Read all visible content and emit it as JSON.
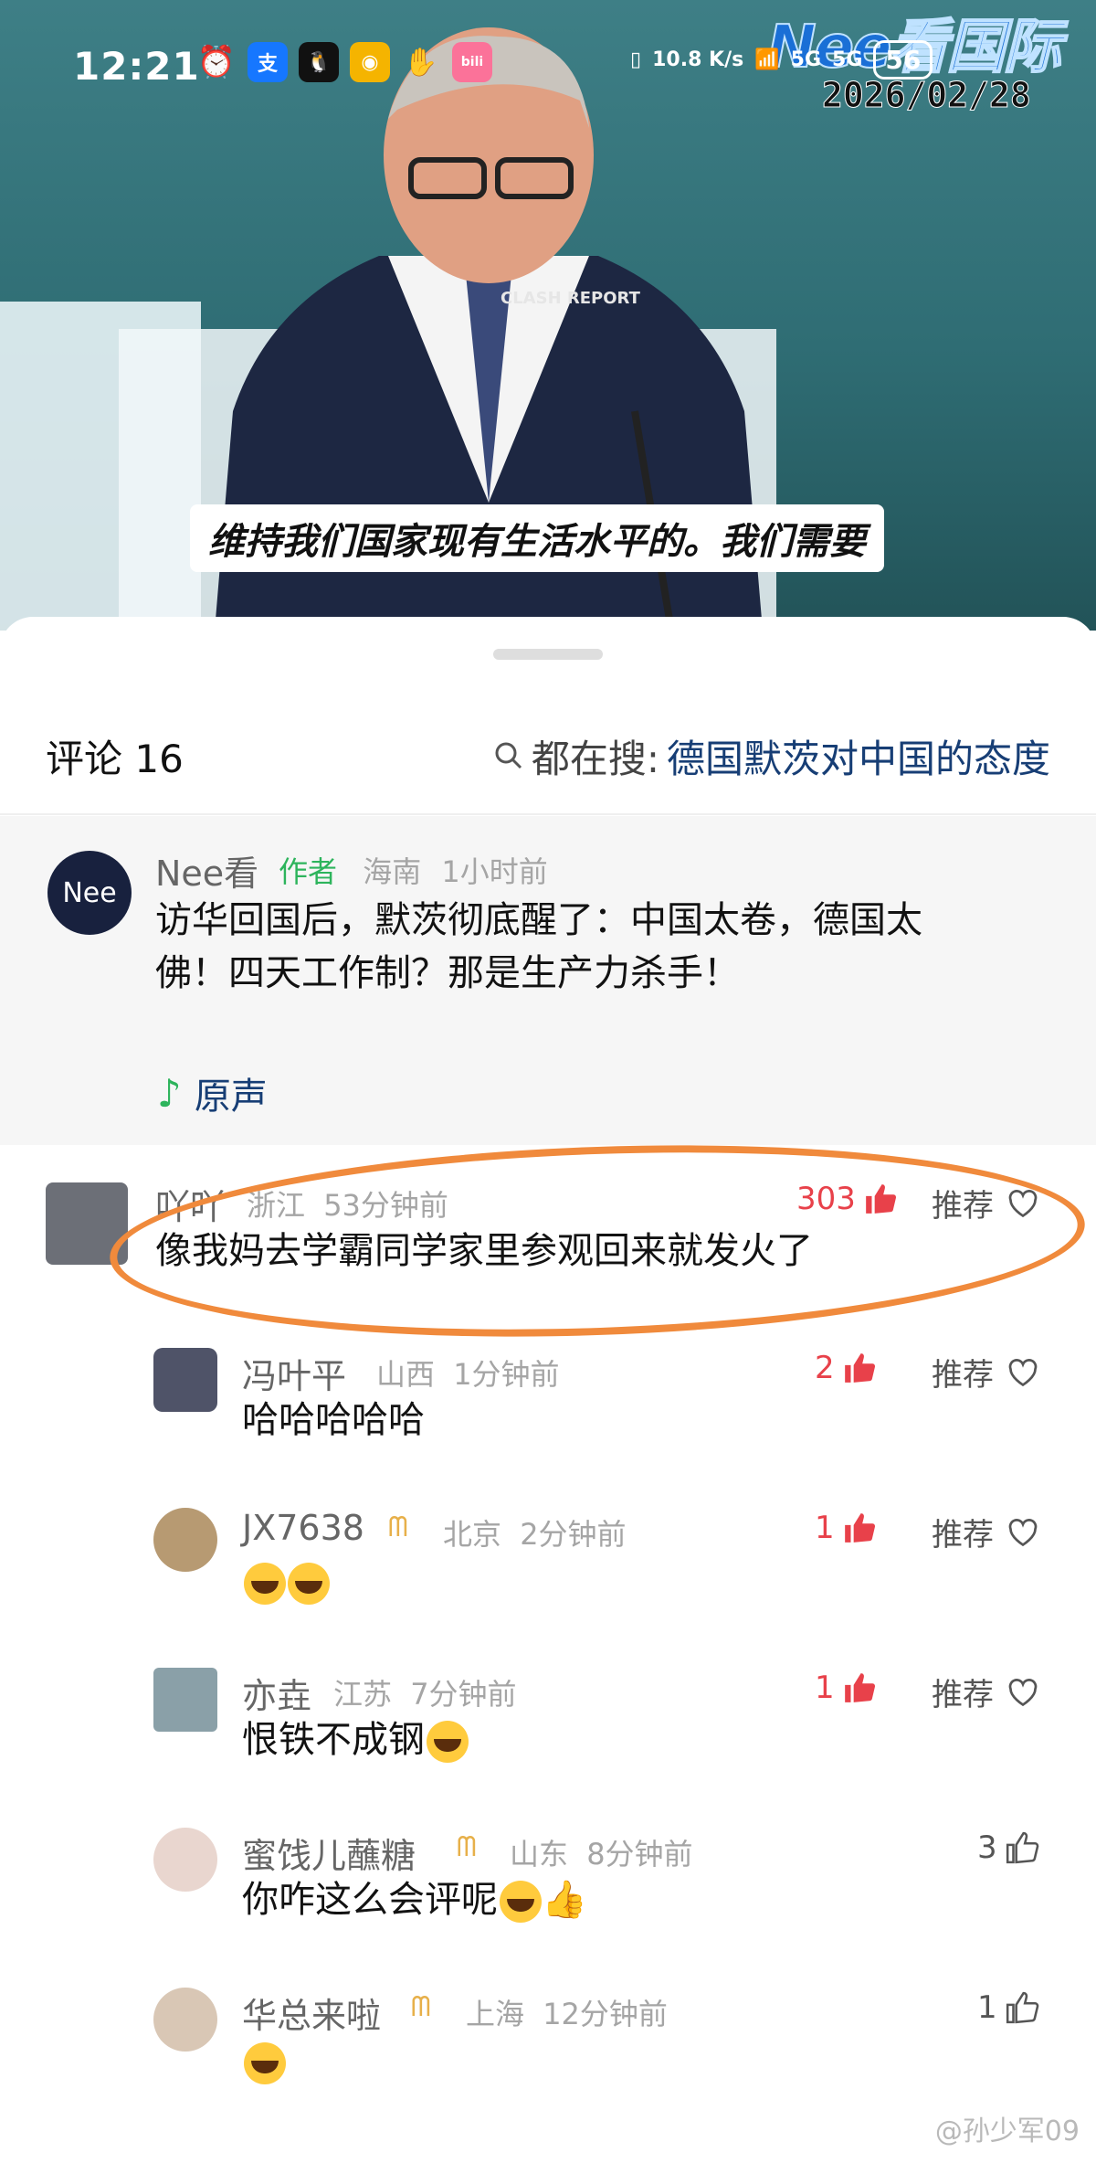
{
  "status_bar": {
    "time": "12:21",
    "net_speed": "10.8 K/s",
    "signal_a": "5G",
    "signal_b": "5G",
    "battery": "56"
  },
  "video": {
    "channel_logo": "Nee看国际",
    "date": "2026/02/28",
    "watermark": "CLASH REPORT",
    "subtitle": "维持我们国家现有生活水平的。我们需要"
  },
  "comments_header": {
    "title": "评论 16",
    "search_prefix": "都在搜:",
    "search_term": "德国默茨对中国的态度"
  },
  "author_post": {
    "avatar_text": "Nee",
    "name": "Nee看",
    "badge": "作者",
    "location": "海南",
    "time": "1小时前",
    "line1": "访华回国后，默茨彻底醒了：中国太卷，德国太",
    "line2": "佛！四天工作制？那是生产力杀手！",
    "original_sound": "原声"
  },
  "comments": [
    {
      "name": "吖吖",
      "location": "浙江",
      "time": "53分钟前",
      "likes": "303",
      "recommend": "推荐",
      "text": "像我妈去学霸同学家里参观回来就发火了"
    },
    {
      "name": "冯叶平",
      "location": "山西",
      "time": "1分钟前",
      "likes": "2",
      "recommend": "推荐",
      "text": "哈哈哈哈哈"
    },
    {
      "name": "JX7638",
      "location": "北京",
      "time": "2分钟前",
      "likes": "1",
      "recommend": "推荐",
      "text": ""
    },
    {
      "name": "亦垚",
      "location": "江苏",
      "time": "7分钟前",
      "likes": "1",
      "recommend": "推荐",
      "text": "恨铁不成钢"
    },
    {
      "name": "蜜饯儿蘸糖",
      "location": "山东",
      "time": "8分钟前",
      "likes": "3",
      "text": "你咋这么会评呢"
    },
    {
      "name": "华总来啦",
      "location": "上海",
      "time": "12分钟前",
      "likes": "1",
      "text": ""
    }
  ],
  "footer_watermark": "@孙少军09",
  "accent_color": "#f08a3c"
}
